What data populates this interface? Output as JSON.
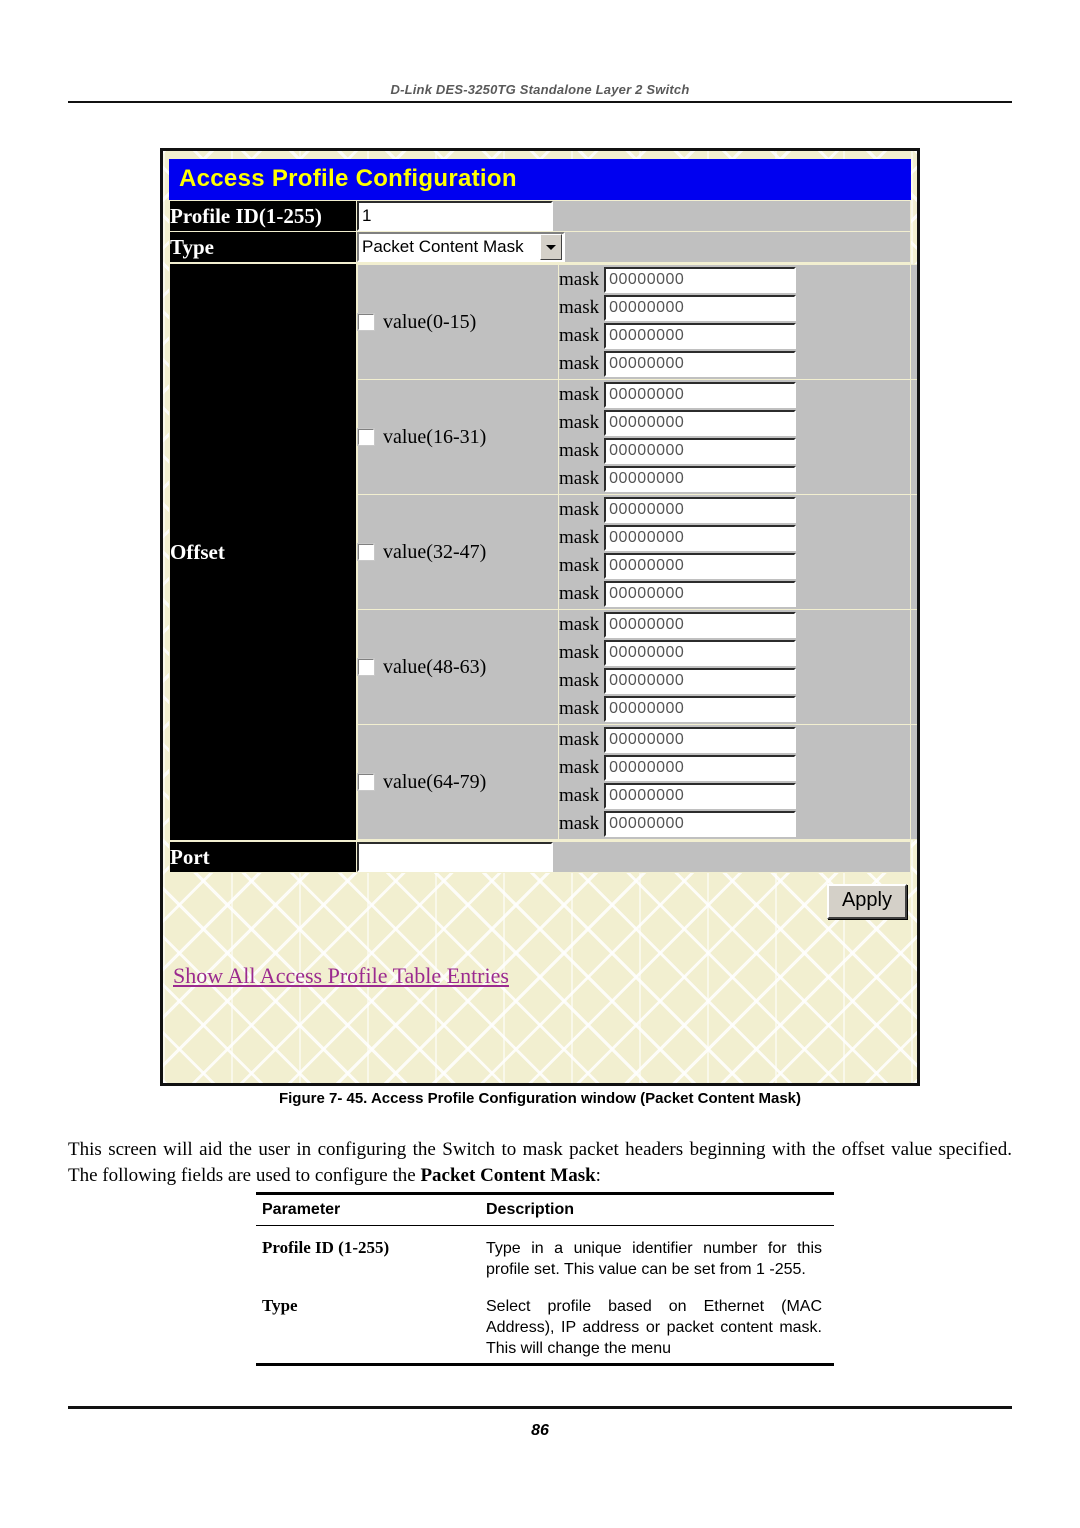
{
  "document": {
    "header": "D-Link DES-3250TG Standalone Layer 2 Switch",
    "figure_caption": "Figure 7- 45. Access Profile Configuration window (Packet Content Mask)",
    "body_paragraph_part1": "This screen will aid the user in configuring the Switch to mask packet headers beginning with the offset value specified. The following fields are used to configure the ",
    "body_paragraph_bold": "Packet Content Mask",
    "body_paragraph_part2": ":",
    "page_number": "86"
  },
  "ui": {
    "title": "Access Profile Configuration",
    "profile_id": {
      "label": "Profile ID(1-255)",
      "value": "1"
    },
    "type": {
      "label": "Type",
      "selected": "Packet Content Mask",
      "arrow_icon": "chevron-down-icon"
    },
    "offset": {
      "label": "Offset",
      "mask_label": "mask",
      "mask_default": "00000000",
      "rows": [
        {
          "label": "value(0-15)",
          "checked": false,
          "masks": [
            "00000000",
            "00000000",
            "00000000",
            "00000000"
          ]
        },
        {
          "label": "value(16-31)",
          "checked": false,
          "masks": [
            "00000000",
            "00000000",
            "00000000",
            "00000000"
          ]
        },
        {
          "label": "value(32-47)",
          "checked": false,
          "masks": [
            "00000000",
            "00000000",
            "00000000",
            "00000000"
          ]
        },
        {
          "label": "value(48-63)",
          "checked": false,
          "masks": [
            "00000000",
            "00000000",
            "00000000",
            "00000000"
          ]
        },
        {
          "label": "value(64-79)",
          "checked": false,
          "masks": [
            "00000000",
            "00000000",
            "00000000",
            "00000000"
          ]
        }
      ]
    },
    "port": {
      "label": "Port",
      "value": ""
    },
    "apply_button": "Apply",
    "show_all_link": "Show All Access Profile Table Entries",
    "colors": {
      "title_bar_bg": "#0000f0",
      "title_bar_fg": "#ffff00",
      "label_bg": "#000000",
      "field_bg": "#c0c0c0",
      "panel_bg": "#f2efd0",
      "link": "#9b2a8f"
    }
  },
  "param_table": {
    "headers": [
      "Parameter",
      "Description"
    ],
    "rows": [
      {
        "parameter": "Profile ID (1-255)",
        "description": "Type in a unique identifier number for this profile set. This value can be set from 1 -255."
      },
      {
        "parameter": "Type",
        "description": "Select profile based on Ethernet (MAC Address), IP address or packet content mask. This will change the menu"
      }
    ]
  }
}
